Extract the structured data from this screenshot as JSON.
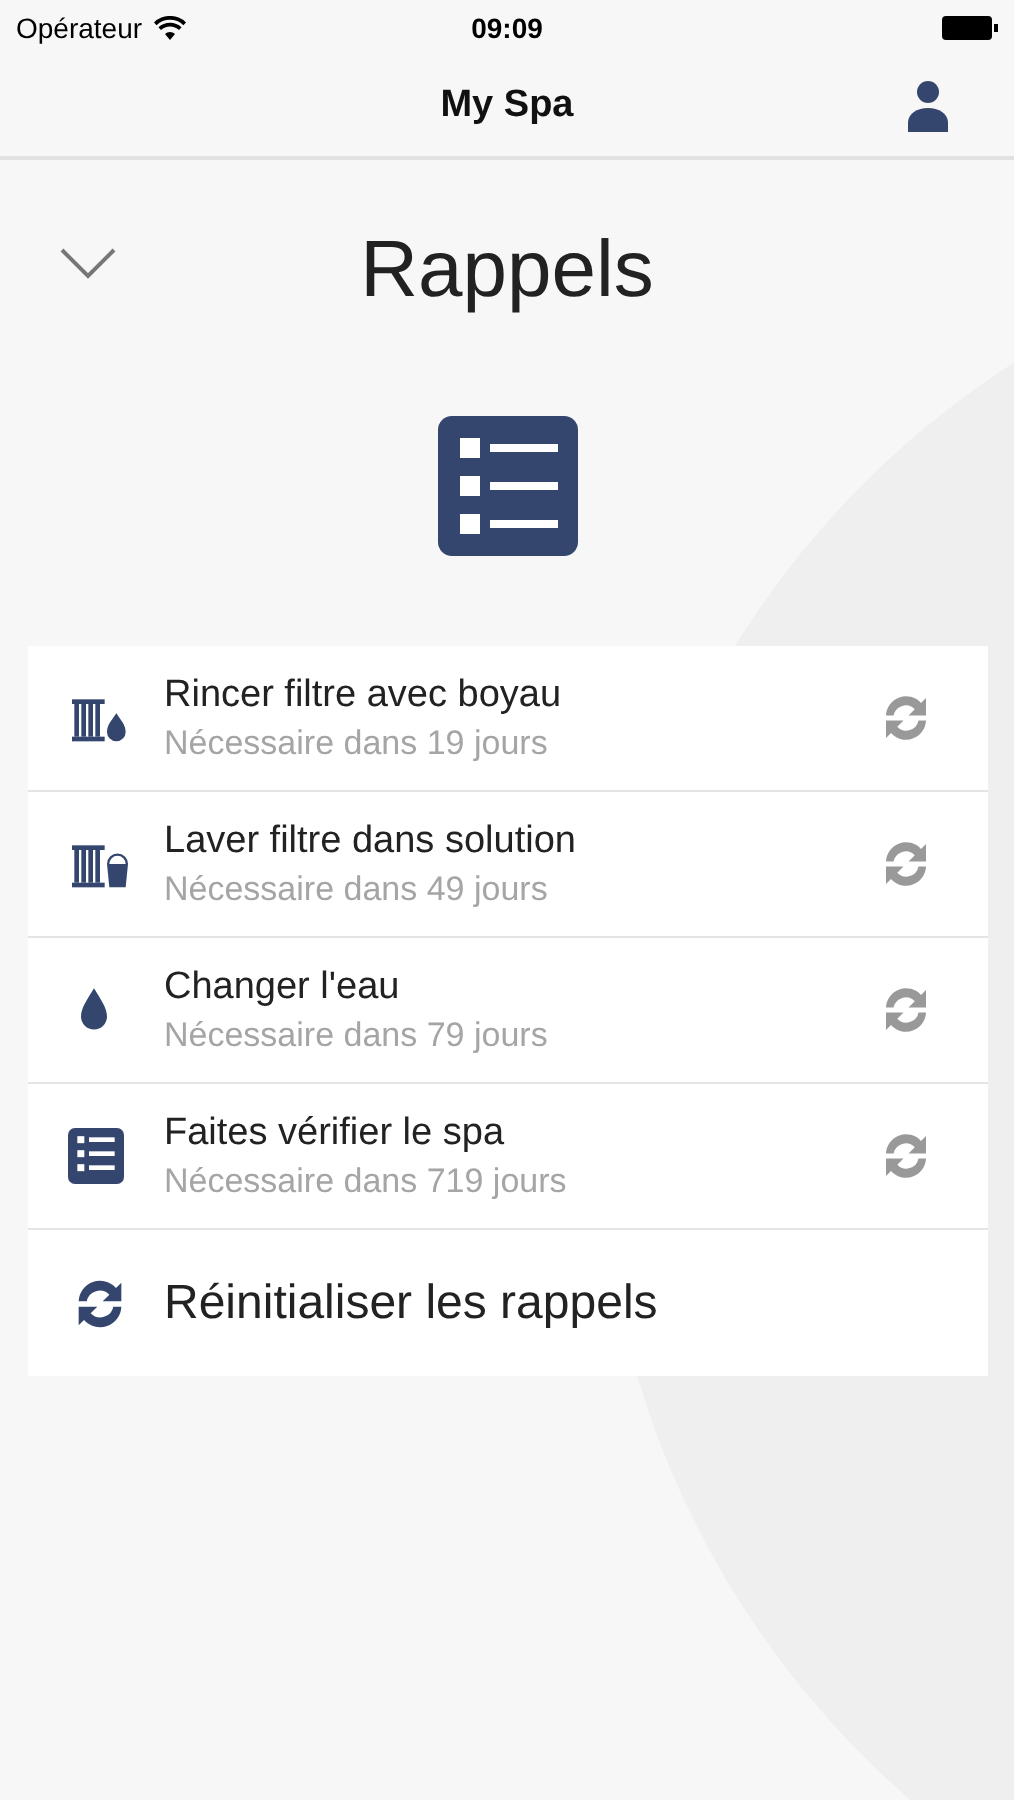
{
  "status_bar": {
    "carrier": "Opérateur",
    "time": "09:09"
  },
  "nav": {
    "title": "My Spa"
  },
  "header": {
    "title": "Rappels"
  },
  "reminders": [
    {
      "kind": "filter-drop",
      "title": "Rincer filtre avec boyau",
      "due": "Nécessaire dans 19 jours"
    },
    {
      "kind": "filter-bucket",
      "title": "Laver filtre dans solution",
      "due": "Nécessaire dans 49 jours"
    },
    {
      "kind": "drop",
      "title": "Changer l'eau",
      "due": "Nécessaire dans 79 jours"
    },
    {
      "kind": "checklist",
      "title": "Faites vérifier le spa",
      "due": "Nécessaire dans 719 jours"
    }
  ],
  "reset": {
    "label": "Réinitialiser les rappels"
  }
}
